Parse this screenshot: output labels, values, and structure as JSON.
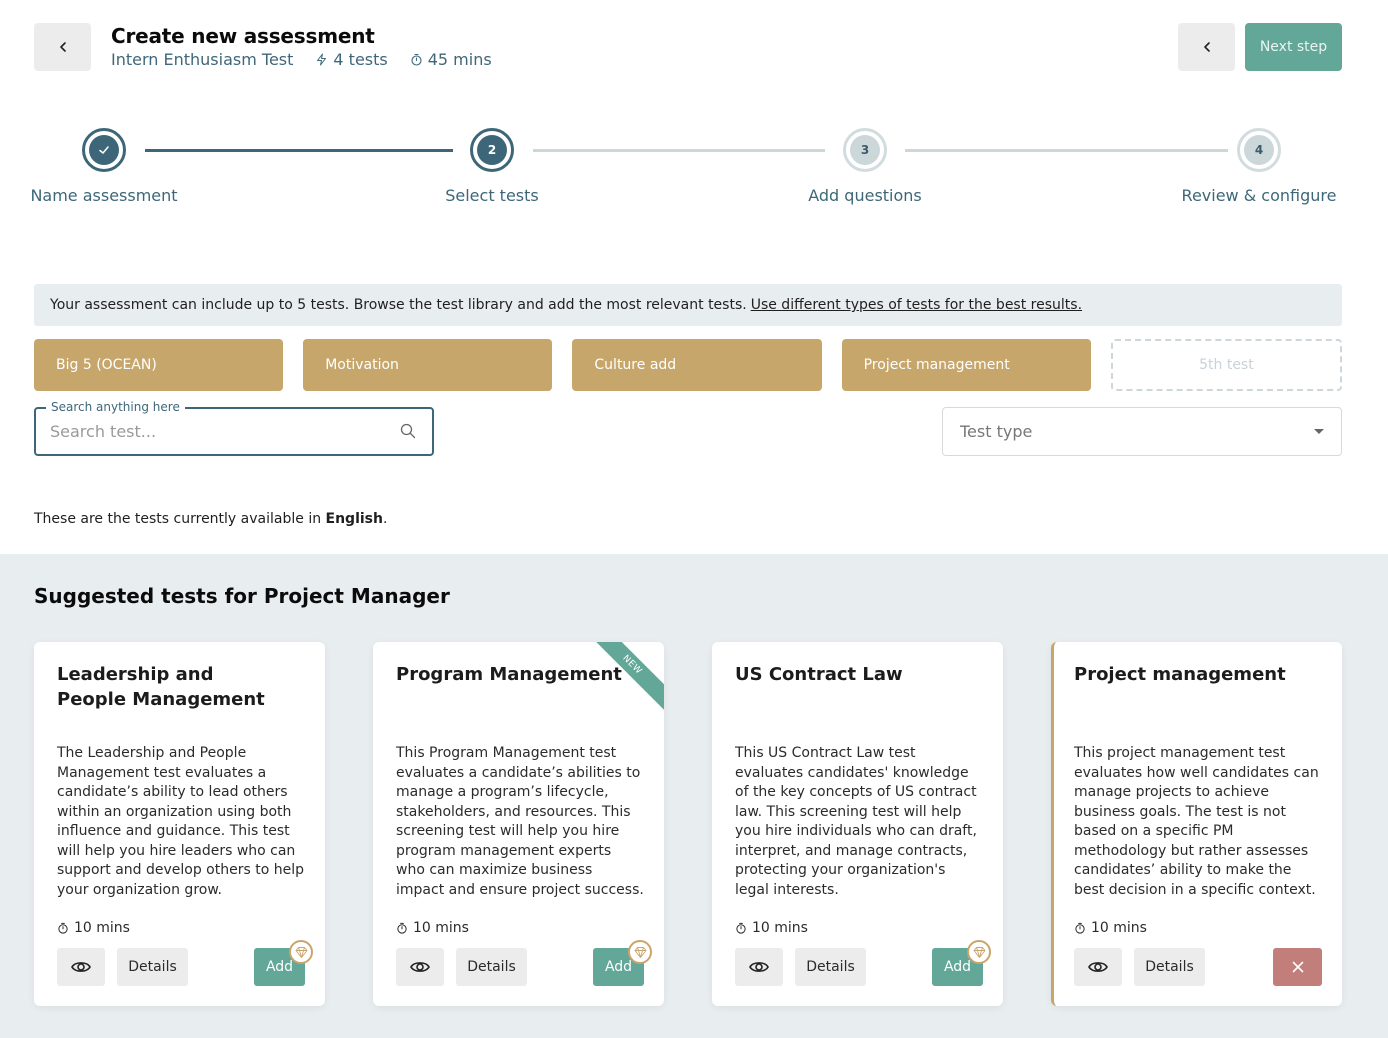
{
  "header": {
    "title": "Create new assessment",
    "assessment_name": "Intern Enthusiasm Test",
    "tests_count": "4 tests",
    "duration": "45 mins",
    "back_icon": "chevron-left-icon",
    "next_label": "Next step"
  },
  "stepper": {
    "steps": [
      {
        "number": "",
        "label": "Name assessment",
        "state": "completed"
      },
      {
        "number": "2",
        "label": "Select tests",
        "state": "current"
      },
      {
        "number": "3",
        "label": "Add questions",
        "state": "pending"
      },
      {
        "number": "4",
        "label": "Review & configure",
        "state": "pending"
      }
    ]
  },
  "info": {
    "text": "Your assessment can include up to 5 tests. Browse the test library and add the most relevant tests.",
    "link": "Use different types of tests for the best results."
  },
  "slots": [
    {
      "label": "Big 5 (OCEAN)",
      "filled": true
    },
    {
      "label": "Motivation",
      "filled": true
    },
    {
      "label": "Culture add",
      "filled": true
    },
    {
      "label": "Project management",
      "filled": true
    },
    {
      "label": "5th test",
      "filled": false
    }
  ],
  "search": {
    "legend": "Search anything here",
    "placeholder": "Search test...",
    "value": ""
  },
  "filter": {
    "placeholder": "Test type"
  },
  "language_note": {
    "prefix": "These are the tests currently available in ",
    "language": "English",
    "suffix": "."
  },
  "suggested": {
    "title": "Suggested tests for Project Manager",
    "cards": [
      {
        "title": "Leadership and People Management",
        "description": "The Leadership and People Management test evaluates a candidate’s ability to lead others within an organization using both influence and guidance. This test will help you hire leaders who can support and develop others to help your organization grow.",
        "duration": "10 mins",
        "details_label": "Details",
        "add_label": "Add",
        "premium": true,
        "is_new": false,
        "selected": false
      },
      {
        "title": "Program Management",
        "description": "This Program Management test evaluates a candidate’s abilities to manage a program’s lifecycle, stakeholders, and resources. This screening test will help you hire program management experts who can maximize business impact and ensure project success.",
        "duration": "10 mins",
        "details_label": "Details",
        "add_label": "Add",
        "premium": true,
        "is_new": true,
        "new_label": "NEW",
        "selected": false
      },
      {
        "title": "US Contract Law",
        "description": "This US Contract Law test evaluates candidates' knowledge of the key concepts of US contract law. This screening test will help you hire individuals who can draft, interpret, and manage contracts, protecting your organization's legal interests.",
        "duration": "10 mins",
        "details_label": "Details",
        "add_label": "Add",
        "premium": true,
        "is_new": false,
        "selected": false
      },
      {
        "title": "Project management",
        "description": "This project management test evaluates how well candidates can manage projects to achieve business goals. The test is not based on a specific PM methodology but rather assesses candidates’ ability to make the best decision in a specific context.",
        "duration": "10 mins",
        "details_label": "Details",
        "premium": false,
        "is_new": false,
        "selected": true
      }
    ]
  },
  "colors": {
    "primary": "#3d6778",
    "accent_green": "#62a798",
    "gold": "#c6a66b",
    "remove_red": "#c27e7b",
    "panel_bg": "#e8edf0"
  }
}
